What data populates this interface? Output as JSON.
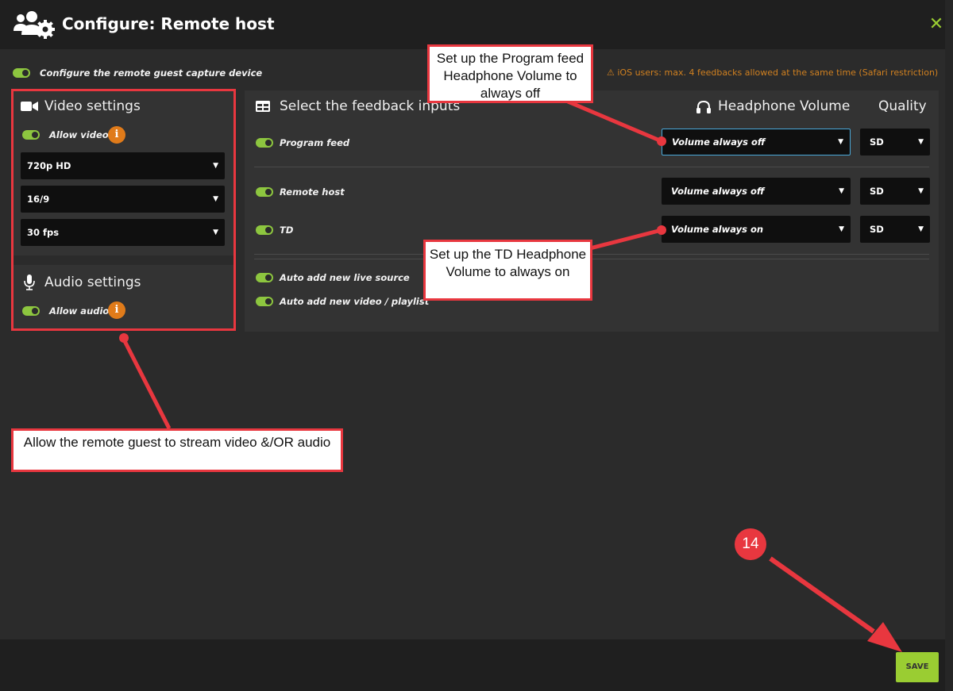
{
  "header": {
    "title": "Configure: Remote host"
  },
  "configure_toggle_label": "Configure the remote guest capture device",
  "ios_notice": "iOS users: max. 4 feedbacks allowed at the same time (Safari restriction)",
  "video": {
    "title": "Video settings",
    "allow_label": "Allow video",
    "resolution": "720p HD",
    "aspect": "16/9",
    "fps": "30 fps"
  },
  "audio": {
    "title": "Audio settings",
    "allow_label": "Allow audio"
  },
  "feedback": {
    "title": "Select the feedback inputs",
    "headphone_header": "Headphone Volume",
    "quality_header": "Quality",
    "rows": [
      {
        "label": "Program feed",
        "volume": "Volume always off",
        "quality": "SD"
      },
      {
        "label": "Remote host",
        "volume": "Volume always off",
        "quality": "SD"
      },
      {
        "label": "TD",
        "volume": "Volume always on",
        "quality": "SD"
      }
    ],
    "auto_live": "Auto add new live source",
    "auto_video": "Auto add new video / playlist"
  },
  "footer": {
    "save_label": "SAVE"
  },
  "annotations": {
    "program_callout": "Set up the Program feed Headphone Volume to always off",
    "td_callout": "Set up the TD Headphone Volume to always on",
    "stream_callout": "Allow the remote guest to stream video &/OR audio",
    "step_number": "14"
  },
  "colors": {
    "accent": "#9acd32",
    "warning": "#d08020",
    "annotation": "#e8373f"
  }
}
